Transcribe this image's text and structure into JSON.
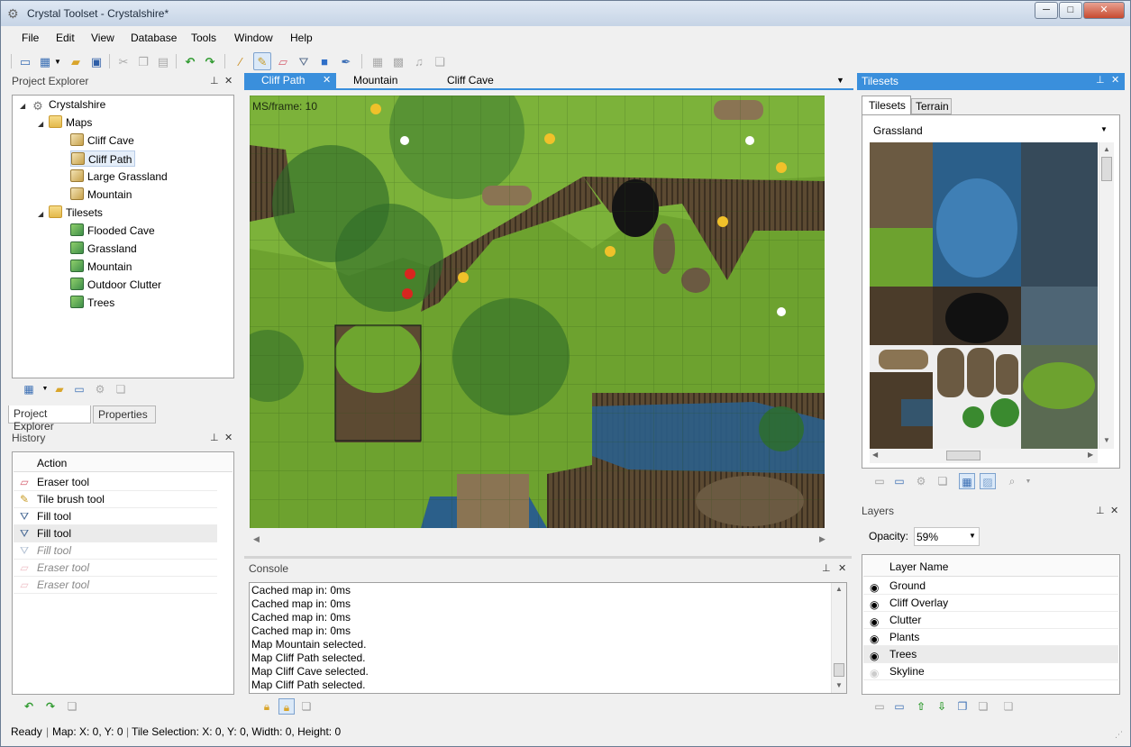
{
  "window": {
    "title": "Crystal Toolset - Crystalshire*",
    "min_glyph": "─",
    "max_glyph": "□",
    "close_glyph": "✕"
  },
  "menu": [
    "File",
    "Edit",
    "View",
    "Database",
    "Tools",
    "Window",
    "Help"
  ],
  "toolbar_icons": [
    "new-map-icon",
    "new-tileset-icon",
    "open-folder-icon",
    "save-icon",
    "cut-icon",
    "copy-icon",
    "paste-icon",
    "undo-icon",
    "redo-icon",
    "magic-wand-icon",
    "tile-brush-icon",
    "eraser-icon",
    "fill-icon",
    "rectangle-icon",
    "eyedropper-icon",
    "grid-icon",
    "map-properties-icon",
    "music-icon",
    "layers-icon"
  ],
  "project_explorer": {
    "title": "Project Explorer",
    "root": "Crystalshire",
    "maps_label": "Maps",
    "maps": [
      "Cliff Cave",
      "Cliff Path",
      "Large Grassland",
      "Mountain"
    ],
    "selected_map": "Cliff Path",
    "tilesets_label": "Tilesets",
    "tilesets": [
      "Flooded Cave",
      "Grassland",
      "Mountain",
      "Outdoor Clutter",
      "Trees"
    ],
    "tabs": [
      "Project Explorer",
      "Properties"
    ]
  },
  "history": {
    "title": "History",
    "column": "Action",
    "items": [
      {
        "label": "Eraser tool",
        "icon": "eraser-icon",
        "state": "done"
      },
      {
        "label": "Tile brush tool",
        "icon": "tile-brush-icon",
        "state": "done"
      },
      {
        "label": "Fill tool",
        "icon": "fill-icon",
        "state": "done"
      },
      {
        "label": "Fill tool",
        "icon": "fill-icon",
        "state": "current"
      },
      {
        "label": "Fill tool",
        "icon": "fill-icon",
        "state": "undone"
      },
      {
        "label": "Eraser tool",
        "icon": "eraser-icon",
        "state": "undone"
      },
      {
        "label": "Eraser tool",
        "icon": "eraser-icon",
        "state": "undone"
      }
    ]
  },
  "documents": {
    "tabs": [
      "Cliff Path",
      "Mountain",
      "Cliff Cave"
    ],
    "active": "Cliff Path",
    "close_glyph": "✕",
    "overflow_glyph": "▼"
  },
  "map_view": {
    "fps_text": "MS/frame:  10"
  },
  "console": {
    "title": "Console",
    "lines": [
      "Cached map in: 0ms",
      "Cached map in: 0ms",
      "Cached map in: 0ms",
      "Cached map in: 0ms",
      "Map Mountain selected.",
      "Map Cliff Path selected.",
      "Map Cliff Cave selected.",
      "Map Cliff Path selected."
    ]
  },
  "tilesets_panel": {
    "title": "Tilesets",
    "tabs": [
      "Tilesets",
      "Terrain"
    ],
    "selected_tileset": "Grassland"
  },
  "layers": {
    "title": "Layers",
    "opacity_label": "Opacity:",
    "opacity_value": "59%",
    "column": "Layer Name",
    "items": [
      {
        "name": "Ground",
        "visible": true
      },
      {
        "name": "Cliff Overlay",
        "visible": true
      },
      {
        "name": "Clutter",
        "visible": true
      },
      {
        "name": "Plants",
        "visible": true
      },
      {
        "name": "Trees",
        "visible": true,
        "current": true
      },
      {
        "name": "Skyline",
        "visible": false
      }
    ]
  },
  "status": {
    "ready": "Ready",
    "map_coords": "Map: X: 0, Y: 0",
    "tile_selection": "Tile Selection: X: 0, Y: 0, Width: 0, Height: 0"
  },
  "colors": {
    "accent": "#3a8fdc",
    "grass": "#6da22f",
    "water": "#2b5f8a",
    "cliff": "#5c4a32"
  }
}
